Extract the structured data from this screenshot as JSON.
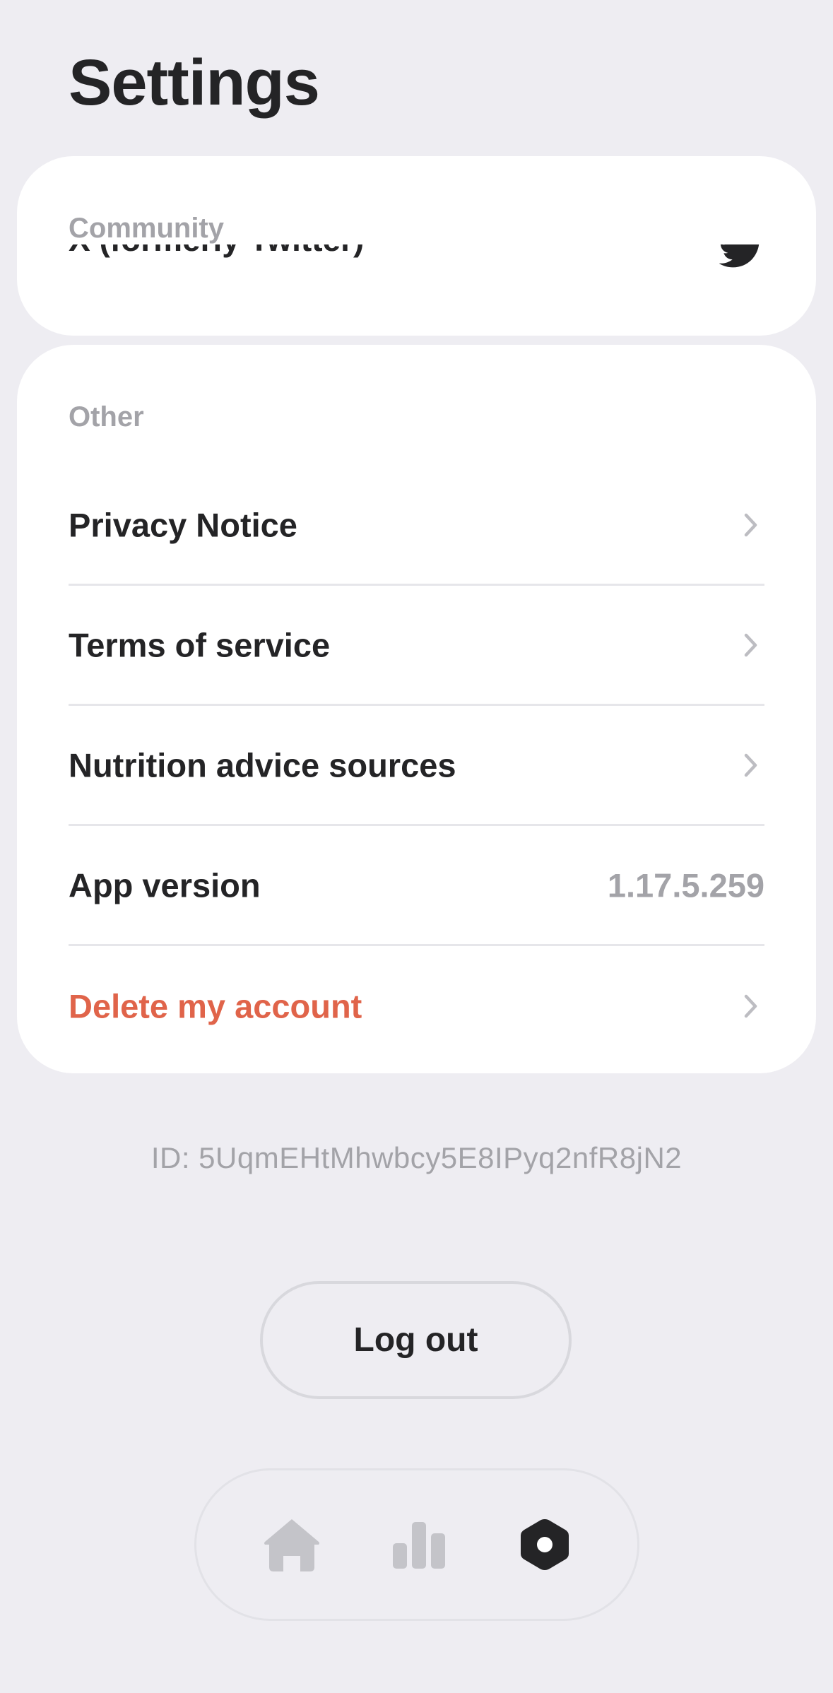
{
  "header": {
    "title": "Settings"
  },
  "community": {
    "label": "Community",
    "row_label": "X (formerly Twitter)",
    "row_icon": "twitter-bird-icon"
  },
  "other": {
    "label": "Other",
    "rows": [
      {
        "label": "Privacy Notice",
        "icon": "chevron-right-icon"
      },
      {
        "label": "Terms of service",
        "icon": "chevron-right-icon"
      },
      {
        "label": "Nutrition advice sources",
        "icon": "chevron-right-icon"
      },
      {
        "label": "App version",
        "value": "1.17.5.259"
      },
      {
        "label": "Delete my account",
        "icon": "chevron-right-icon",
        "color": "#E0644A"
      }
    ]
  },
  "account": {
    "id_text": "ID: 5UqmEHtMhwbcy5E8IPyq2nfR8jN2",
    "logout_label": "Log out"
  },
  "tab_bar": {
    "tabs": [
      {
        "icon": "home-icon",
        "active": false
      },
      {
        "icon": "bar-chart-icon",
        "active": false
      },
      {
        "icon": "settings-icon",
        "active": true
      }
    ]
  },
  "colors": {
    "background": "#EEEDF2",
    "card": "#FFFFFF",
    "text_primary": "#242426",
    "text_secondary": "#A3A3A8",
    "danger": "#E0644A",
    "tab_inactive": "#C4C4C9",
    "tab_active": "#242426"
  }
}
